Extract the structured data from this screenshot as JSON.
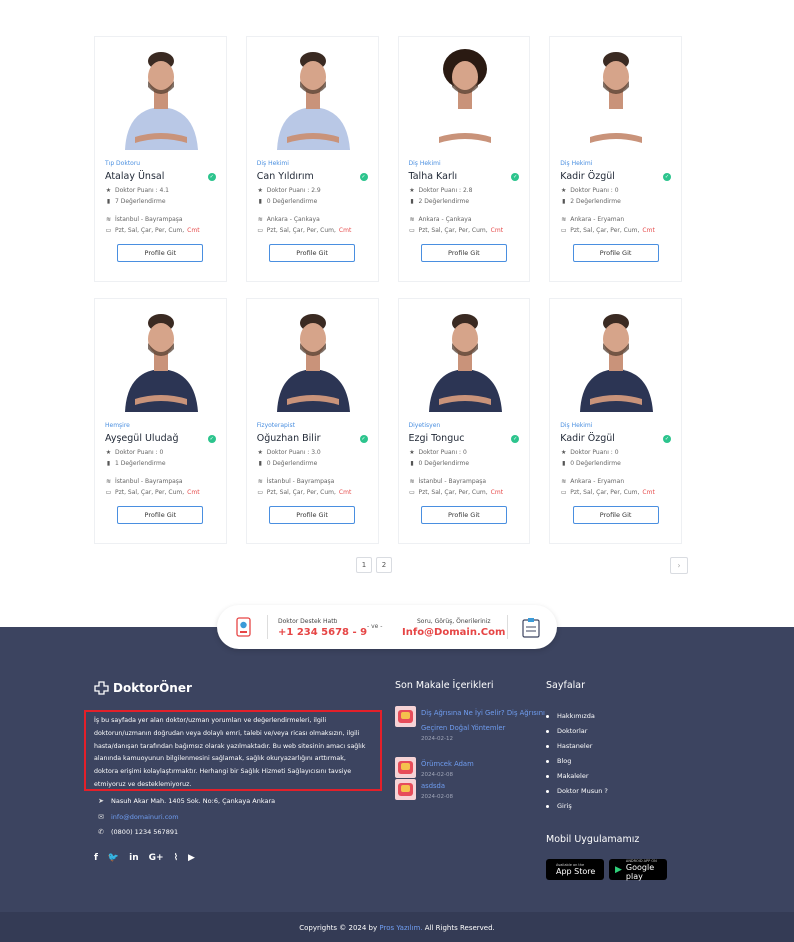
{
  "doctors": [
    {
      "specialty": "Tıp Doktoru",
      "name": "Atalay Ünsal",
      "score": "Doktor Puanı : 4.1",
      "reviews": "7 Değerlendirme",
      "location": "İstanbul - Bayrampaşa",
      "days": "Pzt, Sal, Çar, Per, Cum,",
      "days_extra": "Cmt",
      "button": "Profile Git"
    },
    {
      "specialty": "Diş Hekimi",
      "name": "Can Yıldırım",
      "score": "Doktor Puanı : 2.9",
      "reviews": "0 Değerlendirme",
      "location": "Ankara - Çankaya",
      "days": "Pzt, Sal, Çar, Per, Cum,",
      "days_extra": "Cmt",
      "button": "Profile Git"
    },
    {
      "specialty": "Diş Hekimi",
      "name": "Talha Karlı",
      "score": "Doktor Puanı : 2.8",
      "reviews": "2 Değerlendirme",
      "location": "Ankara - Çankaya",
      "days": "Pzt, Sal, Çar, Per, Cum,",
      "days_extra": "Cmt",
      "button": "Profile Git"
    },
    {
      "specialty": "Diş Hekimi",
      "name": "Kadir Özgül",
      "score": "Doktor Puanı : 0",
      "reviews": "2 Değerlendirme",
      "location": "Ankara - Eryaman",
      "days": "Pzt, Sal, Çar, Per, Cum,",
      "days_extra": "Cmt",
      "button": "Profile Git"
    },
    {
      "specialty": "Hemşire",
      "name": "Ayşegül Uludağ",
      "score": "Doktor Puanı : 0",
      "reviews": "1 Değerlendirme",
      "location": "İstanbul - Bayrampaşa",
      "days": "Pzt, Sal, Çar, Per, Cum,",
      "days_extra": "Cmt",
      "button": "Profile Git"
    },
    {
      "specialty": "Fizyoterapist",
      "name": "Oğuzhan Bilir",
      "score": "Doktor Puanı : 3.0",
      "reviews": "0 Değerlendirme",
      "location": "İstanbul - Bayrampaşa",
      "days": "Pzt, Sal, Çar, Per, Cum,",
      "days_extra": "Cmt",
      "button": "Profile Git"
    },
    {
      "specialty": "Diyetisyen",
      "name": "Ezgi Tonguc",
      "score": "Doktor Puanı : 0",
      "reviews": "0 Değerlendirme",
      "location": "İstanbul - Bayrampaşa",
      "days": "Pzt, Sal, Çar, Per, Cum,",
      "days_extra": "Cmt",
      "button": "Profile Git"
    },
    {
      "specialty": "Diş Hekimi",
      "name": "Kadir Özgül",
      "score": "Doktor Puanı : 0",
      "reviews": "0 Değerlendirme",
      "location": "Ankara - Eryaman",
      "days": "Pzt, Sal, Çar, Per, Cum,",
      "days_extra": "Cmt",
      "button": "Profile Git"
    }
  ],
  "pagination": {
    "pages": [
      "1",
      "2"
    ],
    "next": "›"
  },
  "contact": {
    "support_label": "Doktor Destek Hattı",
    "support_phone": "+1 234 5678 - 9",
    "ve": "- ve -",
    "feedback_label": "Soru, Görüş, Önerileriniz",
    "feedback_email": "Info@Domain.Com"
  },
  "footer": {
    "logo": "DoktorÖner",
    "about": "İş bu sayfada yer alan doktor/uzman yorumları ve değerlendirmeleri, ilgili doktorun/uzmanın doğrudan veya dolaylı emri, talebi ve/veya ricası olmaksızın, ilgili hasta/danışan tarafından bağımsız olarak yazılmaktadır. Bu web sitesinin amacı sağlık alanında kamuoyunun bilgilenmesini sağlamak, sağlık okuryazarlığını arttırmak, doktora erişimi kolaylaştırmaktır. Herhangi bir Sağlık Hizmeti Sağlayıcısını tavsiye etmiyoruz ve desteklemiyoruz.",
    "address": "Nasuh Akar Mah. 1405 Sok. No:6, Çankaya Ankara",
    "email": "info@domainuri.com",
    "phone": "(0800) 1234 567891",
    "articles_title": "Son Makale İçerikleri",
    "articles": [
      {
        "title": "Diş Ağrısına Ne İyi Gelir? Diş Ağrısını Geçiren Doğal Yöntemler",
        "date": "2024-02-12"
      },
      {
        "title": "Örümcek Adam",
        "date": "2024-02-08"
      },
      {
        "title": "asdsda",
        "date": "2024-02-08"
      }
    ],
    "pages_title": "Sayfalar",
    "pages": [
      "Hakkımızda",
      "Doktorlar",
      "Hastaneler",
      "Blog",
      "Makaleler",
      "Doktor Musun ?",
      "Giriş"
    ],
    "mobile_title": "Mobil Uygulamamız",
    "app_store_small": "Available on the",
    "app_store": "App Store",
    "google_small": "ANDROID APP ON",
    "google": "Google play",
    "copyright_pre": "Copyrights © 2024 by",
    "copyright_brand": "Pros Yazılım.",
    "copyright_post": "All Rights Reserved."
  },
  "colors": {
    "accent": "#4a8fe0",
    "footer_bg": "#3c4460",
    "verify": "#2cc48d",
    "highlight_border": "#e3202a"
  }
}
